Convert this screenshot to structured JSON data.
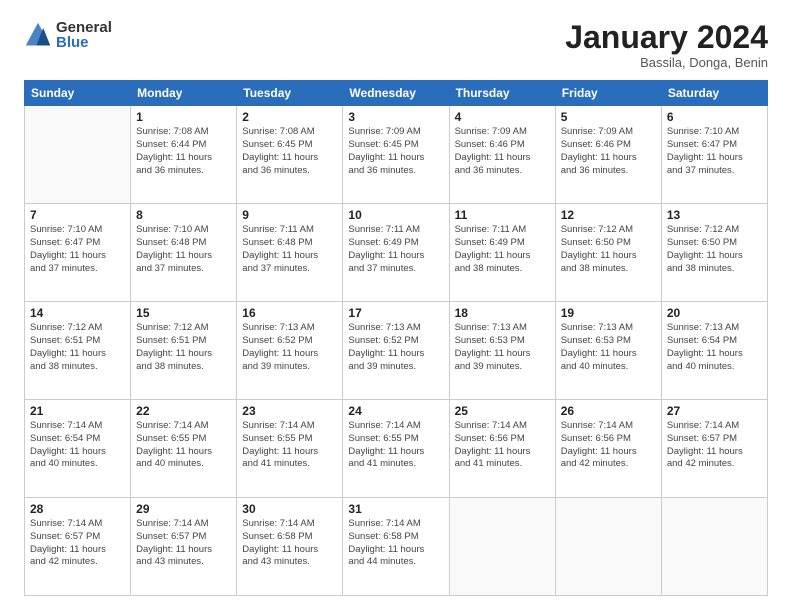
{
  "logo": {
    "general": "General",
    "blue": "Blue"
  },
  "title": "January 2024",
  "subtitle": "Bassila, Donga, Benin",
  "headers": [
    "Sunday",
    "Monday",
    "Tuesday",
    "Wednesday",
    "Thursday",
    "Friday",
    "Saturday"
  ],
  "weeks": [
    [
      {
        "day": "",
        "info": ""
      },
      {
        "day": "1",
        "info": "Sunrise: 7:08 AM\nSunset: 6:44 PM\nDaylight: 11 hours\nand 36 minutes."
      },
      {
        "day": "2",
        "info": "Sunrise: 7:08 AM\nSunset: 6:45 PM\nDaylight: 11 hours\nand 36 minutes."
      },
      {
        "day": "3",
        "info": "Sunrise: 7:09 AM\nSunset: 6:45 PM\nDaylight: 11 hours\nand 36 minutes."
      },
      {
        "day": "4",
        "info": "Sunrise: 7:09 AM\nSunset: 6:46 PM\nDaylight: 11 hours\nand 36 minutes."
      },
      {
        "day": "5",
        "info": "Sunrise: 7:09 AM\nSunset: 6:46 PM\nDaylight: 11 hours\nand 36 minutes."
      },
      {
        "day": "6",
        "info": "Sunrise: 7:10 AM\nSunset: 6:47 PM\nDaylight: 11 hours\nand 37 minutes."
      }
    ],
    [
      {
        "day": "7",
        "info": "Sunrise: 7:10 AM\nSunset: 6:47 PM\nDaylight: 11 hours\nand 37 minutes."
      },
      {
        "day": "8",
        "info": "Sunrise: 7:10 AM\nSunset: 6:48 PM\nDaylight: 11 hours\nand 37 minutes."
      },
      {
        "day": "9",
        "info": "Sunrise: 7:11 AM\nSunset: 6:48 PM\nDaylight: 11 hours\nand 37 minutes."
      },
      {
        "day": "10",
        "info": "Sunrise: 7:11 AM\nSunset: 6:49 PM\nDaylight: 11 hours\nand 37 minutes."
      },
      {
        "day": "11",
        "info": "Sunrise: 7:11 AM\nSunset: 6:49 PM\nDaylight: 11 hours\nand 38 minutes."
      },
      {
        "day": "12",
        "info": "Sunrise: 7:12 AM\nSunset: 6:50 PM\nDaylight: 11 hours\nand 38 minutes."
      },
      {
        "day": "13",
        "info": "Sunrise: 7:12 AM\nSunset: 6:50 PM\nDaylight: 11 hours\nand 38 minutes."
      }
    ],
    [
      {
        "day": "14",
        "info": "Sunrise: 7:12 AM\nSunset: 6:51 PM\nDaylight: 11 hours\nand 38 minutes."
      },
      {
        "day": "15",
        "info": "Sunrise: 7:12 AM\nSunset: 6:51 PM\nDaylight: 11 hours\nand 38 minutes."
      },
      {
        "day": "16",
        "info": "Sunrise: 7:13 AM\nSunset: 6:52 PM\nDaylight: 11 hours\nand 39 minutes."
      },
      {
        "day": "17",
        "info": "Sunrise: 7:13 AM\nSunset: 6:52 PM\nDaylight: 11 hours\nand 39 minutes."
      },
      {
        "day": "18",
        "info": "Sunrise: 7:13 AM\nSunset: 6:53 PM\nDaylight: 11 hours\nand 39 minutes."
      },
      {
        "day": "19",
        "info": "Sunrise: 7:13 AM\nSunset: 6:53 PM\nDaylight: 11 hours\nand 40 minutes."
      },
      {
        "day": "20",
        "info": "Sunrise: 7:13 AM\nSunset: 6:54 PM\nDaylight: 11 hours\nand 40 minutes."
      }
    ],
    [
      {
        "day": "21",
        "info": "Sunrise: 7:14 AM\nSunset: 6:54 PM\nDaylight: 11 hours\nand 40 minutes."
      },
      {
        "day": "22",
        "info": "Sunrise: 7:14 AM\nSunset: 6:55 PM\nDaylight: 11 hours\nand 40 minutes."
      },
      {
        "day": "23",
        "info": "Sunrise: 7:14 AM\nSunset: 6:55 PM\nDaylight: 11 hours\nand 41 minutes."
      },
      {
        "day": "24",
        "info": "Sunrise: 7:14 AM\nSunset: 6:55 PM\nDaylight: 11 hours\nand 41 minutes."
      },
      {
        "day": "25",
        "info": "Sunrise: 7:14 AM\nSunset: 6:56 PM\nDaylight: 11 hours\nand 41 minutes."
      },
      {
        "day": "26",
        "info": "Sunrise: 7:14 AM\nSunset: 6:56 PM\nDaylight: 11 hours\nand 42 minutes."
      },
      {
        "day": "27",
        "info": "Sunrise: 7:14 AM\nSunset: 6:57 PM\nDaylight: 11 hours\nand 42 minutes."
      }
    ],
    [
      {
        "day": "28",
        "info": "Sunrise: 7:14 AM\nSunset: 6:57 PM\nDaylight: 11 hours\nand 42 minutes."
      },
      {
        "day": "29",
        "info": "Sunrise: 7:14 AM\nSunset: 6:57 PM\nDaylight: 11 hours\nand 43 minutes."
      },
      {
        "day": "30",
        "info": "Sunrise: 7:14 AM\nSunset: 6:58 PM\nDaylight: 11 hours\nand 43 minutes."
      },
      {
        "day": "31",
        "info": "Sunrise: 7:14 AM\nSunset: 6:58 PM\nDaylight: 11 hours\nand 44 minutes."
      },
      {
        "day": "",
        "info": ""
      },
      {
        "day": "",
        "info": ""
      },
      {
        "day": "",
        "info": ""
      }
    ]
  ]
}
